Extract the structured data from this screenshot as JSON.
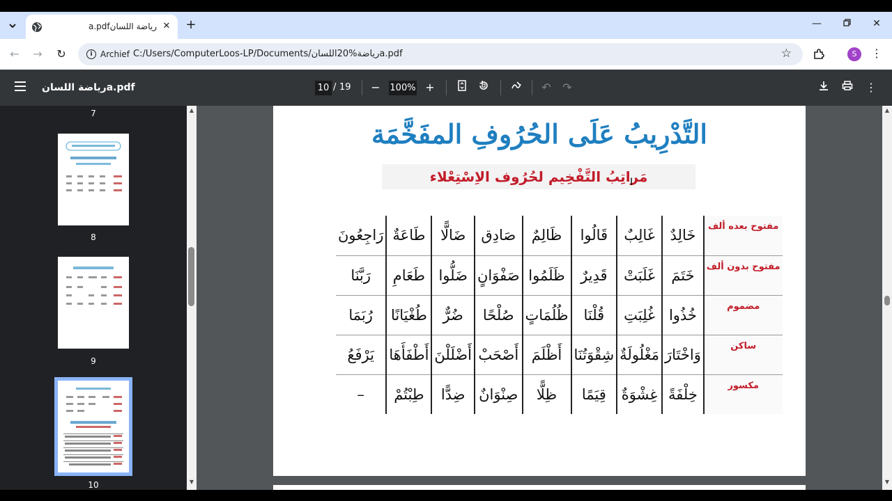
{
  "browser": {
    "tab_title": "رياضة اللسانa.pdf",
    "omnibox_chip": "Archief",
    "url": "C:/Users/ComputerLoos-LP/Documents/رياضة%20اللسانa.pdf",
    "avatar_letter": "S"
  },
  "pdf_toolbar": {
    "doc_name": "رياضة اللسانa.pdf",
    "current_page": "10",
    "page_separator": "/",
    "total_pages": "19",
    "zoom": "100%"
  },
  "sidebar": {
    "thumbnails": [
      {
        "page": "7"
      },
      {
        "page": "8"
      },
      {
        "page": "9"
      },
      {
        "page": "10"
      }
    ]
  },
  "page": {
    "title": "التَّدْرِيبُ عَلَى الحُرُوفِ المفَخَّمَة",
    "subtitle": "مَراتِبُ التَّفْخِيم لحُرُوف الاِسْتِعْلاء",
    "rows": [
      {
        "header": "مفتوح بعده ألف",
        "cells": [
          "خَالِدٌ",
          "غَالِبٌ",
          "قَالُوا",
          "ظَالِمٌ",
          "صَادِق",
          "ضَالًّا",
          "طَاعَةٌ",
          "رَاجِعُونَ"
        ]
      },
      {
        "header": "مفتوح بدون ألف",
        "cells": [
          "خَتَمَ",
          "غَلَبَتْ",
          "قَدِيرٌ",
          "ظَلَمُوا",
          "صَفْوَانٍ",
          "ضَلُّوا",
          "طَعَامِ",
          "رَبَّنَا"
        ]
      },
      {
        "header": "مضموم",
        "cells": [
          "خُذُوا",
          "غُلِبَتِ",
          "قُلْنَا",
          "ظُلُمَاتٍ",
          "صُلْحًا",
          "ضُرٌّ",
          "طُغْيَانًا",
          "رُبَمَا"
        ]
      },
      {
        "header": "ساكن",
        "cells": [
          "وَاخْتَارَ",
          "مَغْلُولَةٌ",
          "شِقْوَتُنَا",
          "أَظْلَمَ",
          "أَصْحَبْ",
          "أَضْلَلْنَ",
          "أَطْفَأَهَا",
          "يَرْفَعُ"
        ]
      },
      {
        "header": "مكسور",
        "cells": [
          "خِلْفَةً",
          "غِشْوَةٌ",
          "قِيَمًا",
          "ظِلًّا",
          "صِنْوَانٌ",
          "ضِدًّا",
          "طِبْتُمْ",
          "–"
        ]
      }
    ]
  }
}
